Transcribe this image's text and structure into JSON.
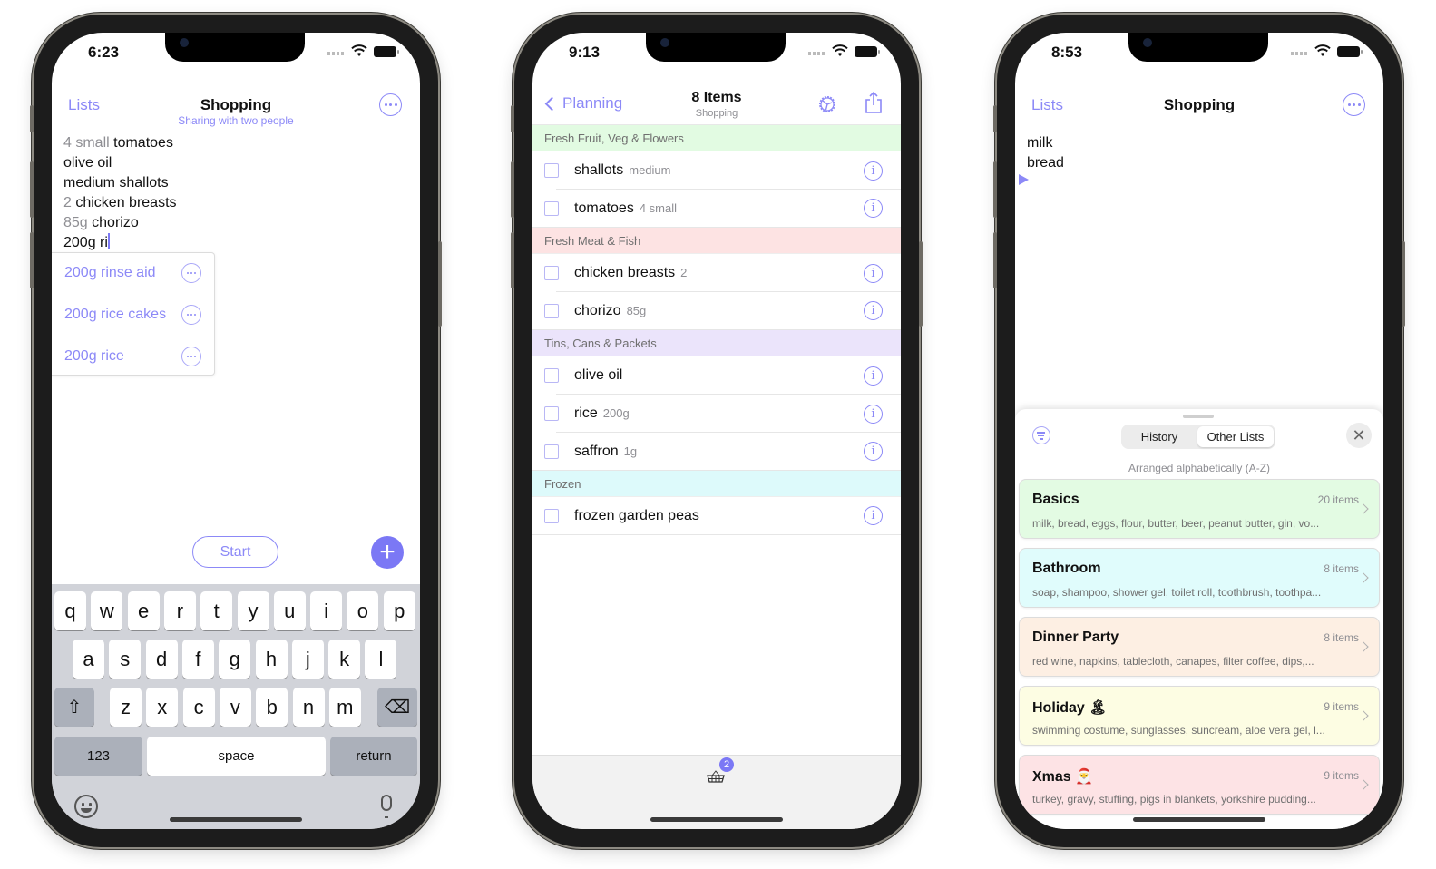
{
  "phone1": {
    "status_time": "6:23",
    "nav": {
      "back_label": "Lists",
      "title": "Shopping",
      "subtitle": "Sharing with two people"
    },
    "editor_lines": [
      {
        "qty": "4 small",
        "text": " tomatoes"
      },
      {
        "qty": "",
        "text": "olive oil"
      },
      {
        "qty": "",
        "text": "medium shallots"
      },
      {
        "qty": "2",
        "text": " chicken breasts"
      },
      {
        "qty": "85g",
        "text": " chorizo"
      },
      {
        "qty": "",
        "text": "200g ri"
      }
    ],
    "suggestions": [
      "200g rinse aid",
      "200g rice cakes",
      "200g rice"
    ],
    "start_label": "Start",
    "add_label": "+",
    "keyboard": {
      "row1": [
        "q",
        "w",
        "e",
        "r",
        "t",
        "y",
        "u",
        "i",
        "o",
        "p"
      ],
      "row2": [
        "a",
        "s",
        "d",
        "f",
        "g",
        "h",
        "j",
        "k",
        "l"
      ],
      "row3": [
        "z",
        "x",
        "c",
        "v",
        "b",
        "n",
        "m"
      ],
      "shift": "⇧",
      "delete": "⌫",
      "numbers": "123",
      "space": "space",
      "return": "return"
    }
  },
  "phone2": {
    "status_time": "9:13",
    "nav": {
      "back_label": "Planning",
      "title": "8 Items",
      "subtitle": "Shopping"
    },
    "sections": [
      {
        "name": "Fresh Fruit, Veg & Flowers",
        "color": "#e2fbe2",
        "items": [
          {
            "name": "shallots",
            "qty": "medium"
          },
          {
            "name": "tomatoes",
            "qty": "4 small"
          }
        ]
      },
      {
        "name": "Fresh Meat & Fish",
        "color": "#fde3e3",
        "items": [
          {
            "name": "chicken breasts",
            "qty": "2"
          },
          {
            "name": "chorizo",
            "qty": "85g"
          }
        ]
      },
      {
        "name": "Tins, Cans & Packets",
        "color": "#ebe4fb",
        "items": [
          {
            "name": "olive oil",
            "qty": ""
          },
          {
            "name": "rice",
            "qty": "200g"
          },
          {
            "name": "saffron",
            "qty": "1g"
          }
        ]
      },
      {
        "name": "Frozen",
        "color": "#ddfafb",
        "items": [
          {
            "name": "frozen garden peas",
            "qty": ""
          }
        ]
      }
    ],
    "info_glyph": "i",
    "basket_badge": "2"
  },
  "phone3": {
    "status_time": "8:53",
    "nav": {
      "back_label": "Lists",
      "title": "Shopping"
    },
    "editor_lines": [
      "milk",
      "bread"
    ],
    "sheet": {
      "segments": [
        "History",
        "Other Lists"
      ],
      "active_segment": "Other Lists",
      "close_glyph": "✕",
      "arranged_label": "Arranged alphabetically (A-Z)",
      "lists": [
        {
          "title": "Basics",
          "count": "20 items",
          "summary": "milk, bread, eggs, flour, butter, beer, peanut butter, gin, vo...",
          "color": "#e3fbe3"
        },
        {
          "title": "Bathroom",
          "count": "8 items",
          "summary": "soap, shampoo, shower gel, toilet roll, toothbrush, toothpa...",
          "color": "#e0fcfc"
        },
        {
          "title": "Dinner Party",
          "count": "8 items",
          "summary": "red wine, napkins, tablecloth, canapes, filter coffee, dips,...",
          "color": "#fdefe3"
        },
        {
          "title": "Holiday 🏝",
          "count": "9 items",
          "summary": "swimming costume, sunglasses, suncream, aloe vera gel, l...",
          "color": "#fdfde3"
        },
        {
          "title": "Xmas 🎅",
          "count": "9 items",
          "summary": "turkey, gravy, stuffing, pigs in blankets, yorkshire pudding...",
          "color": "#fde3e5"
        }
      ]
    }
  },
  "colors": {
    "accent": "#7b78f5",
    "accent_light": "#8c89f7"
  }
}
